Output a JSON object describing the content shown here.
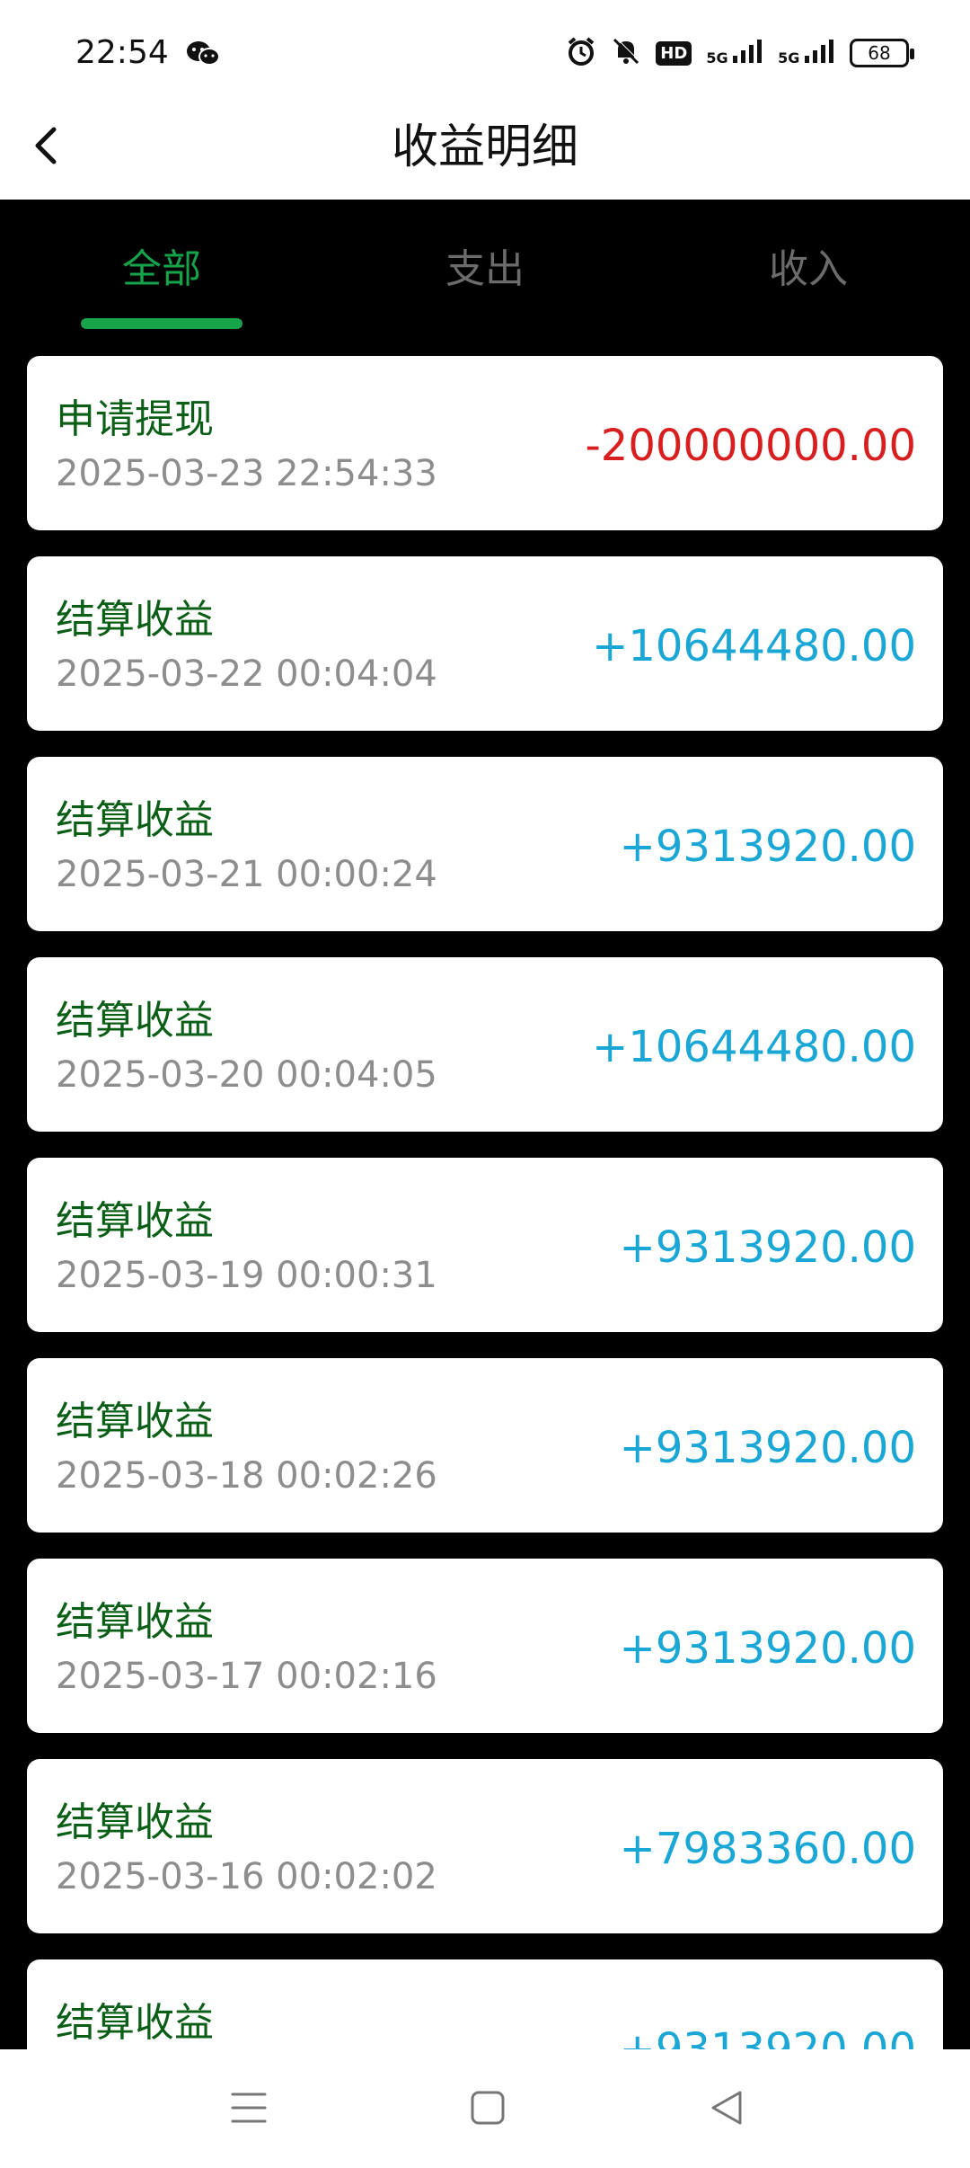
{
  "status_bar": {
    "time": "22:54",
    "hd_label": "HD",
    "signal1_label": "5G",
    "signal2_label": "5G",
    "battery": "68"
  },
  "header": {
    "title": "收益明细"
  },
  "tabs": [
    {
      "label": "全部",
      "active": true
    },
    {
      "label": "支出",
      "active": false
    },
    {
      "label": "收入",
      "active": false
    }
  ],
  "items": [
    {
      "title": "申请提现",
      "time": "2025-03-23 22:54:33",
      "amount": "-200000000.00",
      "type": "neg"
    },
    {
      "title": "结算收益",
      "time": "2025-03-22 00:04:04",
      "amount": "+10644480.00",
      "type": "pos"
    },
    {
      "title": "结算收益",
      "time": "2025-03-21 00:00:24",
      "amount": "+9313920.00",
      "type": "pos"
    },
    {
      "title": "结算收益",
      "time": "2025-03-20 00:04:05",
      "amount": "+10644480.00",
      "type": "pos"
    },
    {
      "title": "结算收益",
      "time": "2025-03-19 00:00:31",
      "amount": "+9313920.00",
      "type": "pos"
    },
    {
      "title": "结算收益",
      "time": "2025-03-18 00:02:26",
      "amount": "+9313920.00",
      "type": "pos"
    },
    {
      "title": "结算收益",
      "time": "2025-03-17 00:02:16",
      "amount": "+9313920.00",
      "type": "pos"
    },
    {
      "title": "结算收益",
      "time": "2025-03-16 00:02:02",
      "amount": "+7983360.00",
      "type": "pos"
    },
    {
      "title": "结算收益",
      "time": "",
      "amount": "+9313920.00",
      "type": "pos"
    }
  ],
  "colors": {
    "accent": "#16a34a",
    "negative": "#d81e1e",
    "positive": "#1aa7d6",
    "title_green": "#0b5e16"
  },
  "icons": [
    "back-chevron-icon",
    "wechat-icon",
    "alarm-icon",
    "mute-bell-icon",
    "menu-icon",
    "home-square-icon",
    "back-triangle-icon"
  ]
}
